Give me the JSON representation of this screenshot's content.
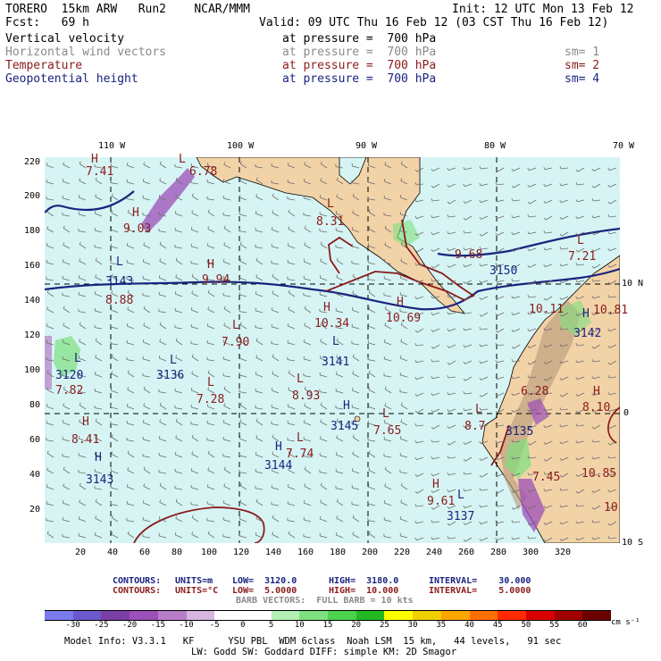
{
  "header": {
    "model": "TORERO  15km ARW   Run2    NCAR/MMM",
    "init": "Init: 12 UTC Mon 13 Feb 12",
    "fcst": "Fcst:   69 h",
    "valid": "Valid: 09 UTC Thu 16 Feb 12 (03 CST Thu 16 Feb 12)"
  },
  "fields": [
    {
      "name": "Vertical velocity",
      "level": "at pressure =  700 hPa",
      "sm": "",
      "color": "#000000"
    },
    {
      "name": "Horizontal wind vectors",
      "level": "at pressure =  700 hPa",
      "sm": "sm= 1",
      "color": "#8a8a8a"
    },
    {
      "name": "Temperature",
      "level": "at pressure =  700 hPa",
      "sm": "sm= 2",
      "color": "#8b1a1a"
    },
    {
      "name": "Geopotential height",
      "level": "at pressure =  700 hPa",
      "sm": "sm= 4",
      "color": "#1a237e"
    }
  ],
  "axes": {
    "top_lon": [
      "110 W",
      "100 W",
      "90 W",
      "80 W",
      "70 W"
    ],
    "right_lat": [
      "10 N",
      "0",
      "10 S"
    ],
    "left_y": [
      "220",
      "200",
      "180",
      "160",
      "140",
      "120",
      "100",
      "80",
      "60",
      "40",
      "20"
    ],
    "bottom_x": [
      "20",
      "40",
      "60",
      "80",
      "100",
      "120",
      "140",
      "160",
      "180",
      "200",
      "220",
      "240",
      "260",
      "280",
      "300",
      "320"
    ]
  },
  "map_labels": {
    "highs": [
      {
        "sym": "H",
        "val": "7.41",
        "color": "#8b1a1a"
      },
      {
        "sym": "H",
        "val": "9.03",
        "color": "#8b1a1a"
      },
      {
        "sym": "H",
        "val": "9.94",
        "color": "#8b1a1a"
      },
      {
        "sym": "H",
        "val": "10.34",
        "color": "#8b1a1a"
      },
      {
        "sym": "H",
        "val": "10.69",
        "color": "#8b1a1a"
      },
      {
        "sym": "H",
        "val": "9.68",
        "color": "#8b1a1a"
      },
      {
        "sym": "H",
        "val": "8.41",
        "color": "#8b1a1a"
      },
      {
        "sym": "H",
        "val": "9.61",
        "color": "#8b1a1a"
      },
      {
        "sym": "H",
        "val": "8.10",
        "color": "#8b1a1a"
      },
      {
        "sym": "H",
        "val": "10.81",
        "color": "#8b1a1a"
      },
      {
        "sym": "H",
        "val": "3143",
        "color": "#1a237e"
      },
      {
        "sym": "H",
        "val": "3144",
        "color": "#1a237e"
      },
      {
        "sym": "H",
        "val": "3145",
        "color": "#1a237e"
      },
      {
        "sym": "H",
        "val": "3142",
        "color": "#1a237e"
      }
    ],
    "lows": [
      {
        "sym": "L",
        "val": "6.78",
        "color": "#8b1a1a"
      },
      {
        "sym": "L",
        "val": "8.31",
        "color": "#8b1a1a"
      },
      {
        "sym": "L",
        "val": "8.88",
        "color": "#8b1a1a"
      },
      {
        "sym": "L",
        "val": "7.90",
        "color": "#8b1a1a"
      },
      {
        "sym": "L",
        "val": "7.28",
        "color": "#8b1a1a"
      },
      {
        "sym": "L",
        "val": "7.82",
        "color": "#8b1a1a"
      },
      {
        "sym": "L",
        "val": "8.93",
        "color": "#8b1a1a"
      },
      {
        "sym": "L",
        "val": "7.74",
        "color": "#8b1a1a"
      },
      {
        "sym": "L",
        "val": "7.65",
        "color": "#8b1a1a"
      },
      {
        "sym": "L",
        "val": "8.7",
        "color": "#8b1a1a"
      },
      {
        "sym": "L",
        "val": "7.21",
        "color": "#8b1a1a"
      },
      {
        "sym": "L",
        "val": "10.11",
        "color": "#8b1a1a"
      },
      {
        "sym": "L",
        "val": "6.28",
        "color": "#8b1a1a"
      },
      {
        "sym": "L",
        "val": "7.45",
        "color": "#8b1a1a"
      },
      {
        "sym": "L",
        "val": "10.85",
        "color": "#8b1a1a"
      },
      {
        "sym": "L",
        "val": "10",
        "color": "#8b1a1a"
      },
      {
        "sym": "L",
        "val": "3143",
        "color": "#1a237e"
      },
      {
        "sym": "L",
        "val": "3141",
        "color": "#1a237e"
      },
      {
        "sym": "L",
        "val": "3136",
        "color": "#1a237e"
      },
      {
        "sym": "L",
        "val": "3120",
        "color": "#1a237e"
      },
      {
        "sym": "L",
        "val": "3135",
        "color": "#1a237e"
      },
      {
        "sym": "L",
        "val": "3137",
        "color": "#1a237e"
      },
      {
        "sym": "L",
        "val": "3150",
        "color": "#1a237e"
      }
    ]
  },
  "contour_info": [
    {
      "label": "CONTOURS:",
      "units": "UNITS=m",
      "low": "LOW=  3120.0",
      "high": "HIGH=  3180.0",
      "interval": "INTERVAL=    30.000",
      "color": "#1a237e"
    },
    {
      "label": "CONTOURS:",
      "units": "UNITS=°C",
      "low": "LOW=  5.0000",
      "high": "HIGH=  10.000",
      "interval": "INTERVAL=    5.0000",
      "color": "#8b1a1a"
    }
  ],
  "barb_info": "BARB VECTORS:  FULL BARB = 10 kts",
  "colorbar": {
    "labels": [
      "-30",
      "-25",
      "-20",
      "-15",
      "-10",
      "-5",
      "0",
      "5",
      "10",
      "15",
      "20",
      "25",
      "30",
      "35",
      "40",
      "45",
      "50",
      "55",
      "60"
    ],
    "units": "cm s⁻¹",
    "colors": [
      "#7b7bf0",
      "#6a5acd",
      "#7b3fa8",
      "#9b4fb8",
      "#b77dc8",
      "#d8b6e0",
      "#ffffff",
      "#ffffff",
      "#b3f0b3",
      "#7ee07e",
      "#4cd24c",
      "#22b822",
      "#ffff00",
      "#f0d000",
      "#ffa500",
      "#ff7000",
      "#ff2a00",
      "#d80000",
      "#a00000",
      "#6a0000"
    ]
  },
  "footer": {
    "line1": "Model Info: V3.3.1   KF      YSU PBL  WDM 6class  Noah LSM  15 km,   44 levels,   91 sec",
    "line2": "LW: Godd SW: Goddard DIFF: simple KM: 2D Smagor"
  }
}
